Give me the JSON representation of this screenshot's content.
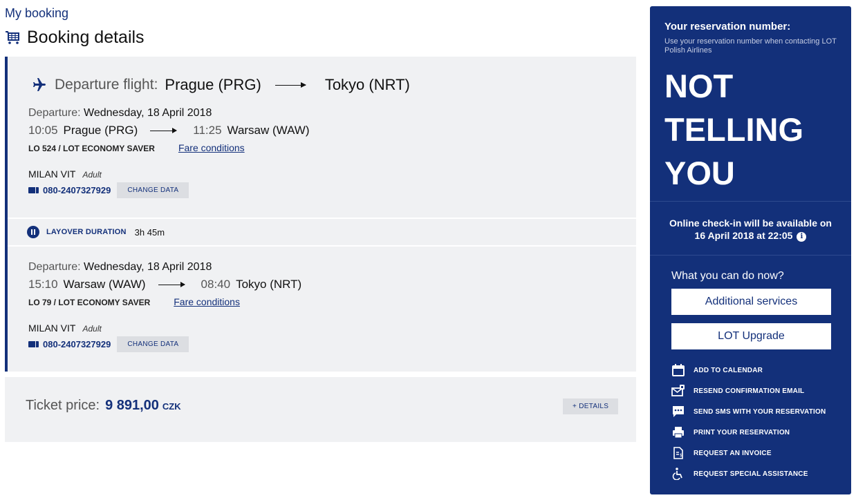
{
  "breadcrumb": "My booking",
  "page_title": "Booking details",
  "flight": {
    "label": "Departure flight:",
    "from": "Prague (PRG)",
    "to": "Tokyo (NRT)"
  },
  "segments": [
    {
      "dep_label": "Departure:",
      "dep_date": "Wednesday, 18 April 2018",
      "dep_time": "10:05",
      "dep_city": "Prague (PRG)",
      "arr_time": "11:25",
      "arr_city": "Warsaw (WAW)",
      "flight_no": "LO 524 / LOT ECONOMY SAVER",
      "fare_link": "Fare conditions",
      "pax_name": "MILAN VIT",
      "pax_type": "Adult",
      "ticket": "080-2407327929",
      "change_btn": "CHANGE DATA"
    },
    {
      "dep_label": "Departure:",
      "dep_date": "Wednesday, 18 April 2018",
      "dep_time": "15:10",
      "dep_city": "Warsaw (WAW)",
      "arr_time": "08:40",
      "arr_city": "Tokyo (NRT)",
      "flight_no": "LO 79 / LOT ECONOMY SAVER",
      "fare_link": "Fare conditions",
      "pax_name": "MILAN VIT",
      "pax_type": "Adult",
      "ticket": "080-2407327929",
      "change_btn": "CHANGE DATA"
    }
  ],
  "layover": {
    "label": "LAYOVER DURATION",
    "duration": "3h 45m"
  },
  "price": {
    "label": "Ticket price:",
    "value": "9 891,00",
    "currency": "CZK",
    "details_btn": "+ DETAILS"
  },
  "sidebar": {
    "res_label": "Your reservation number:",
    "res_sub": "Use your reservation number when contacting LOT Polish Airlines",
    "res_number": "NOT\nTELLING\nYOU",
    "checkin_line1": "Online check-in will be available on",
    "checkin_line2": "16 April 2018 at 22:05",
    "what_now": "What you can do now?",
    "btn_additional": "Additional services",
    "btn_upgrade": "LOT Upgrade",
    "actions": [
      {
        "label": "ADD TO CALENDAR",
        "icon": "calendar-icon"
      },
      {
        "label": "RESEND CONFIRMATION EMAIL",
        "icon": "email-icon"
      },
      {
        "label": "SEND SMS WITH YOUR RESERVATION",
        "icon": "sms-icon"
      },
      {
        "label": "PRINT YOUR RESERVATION",
        "icon": "printer-icon"
      },
      {
        "label": "REQUEST AN INVOICE",
        "icon": "invoice-icon"
      },
      {
        "label": "REQUEST SPECIAL ASSISTANCE",
        "icon": "wheelchair-icon"
      }
    ]
  },
  "colors": {
    "brand_navy": "#13307a",
    "card_bg": "#f0f1f3",
    "button_grey": "#dcdee2"
  }
}
